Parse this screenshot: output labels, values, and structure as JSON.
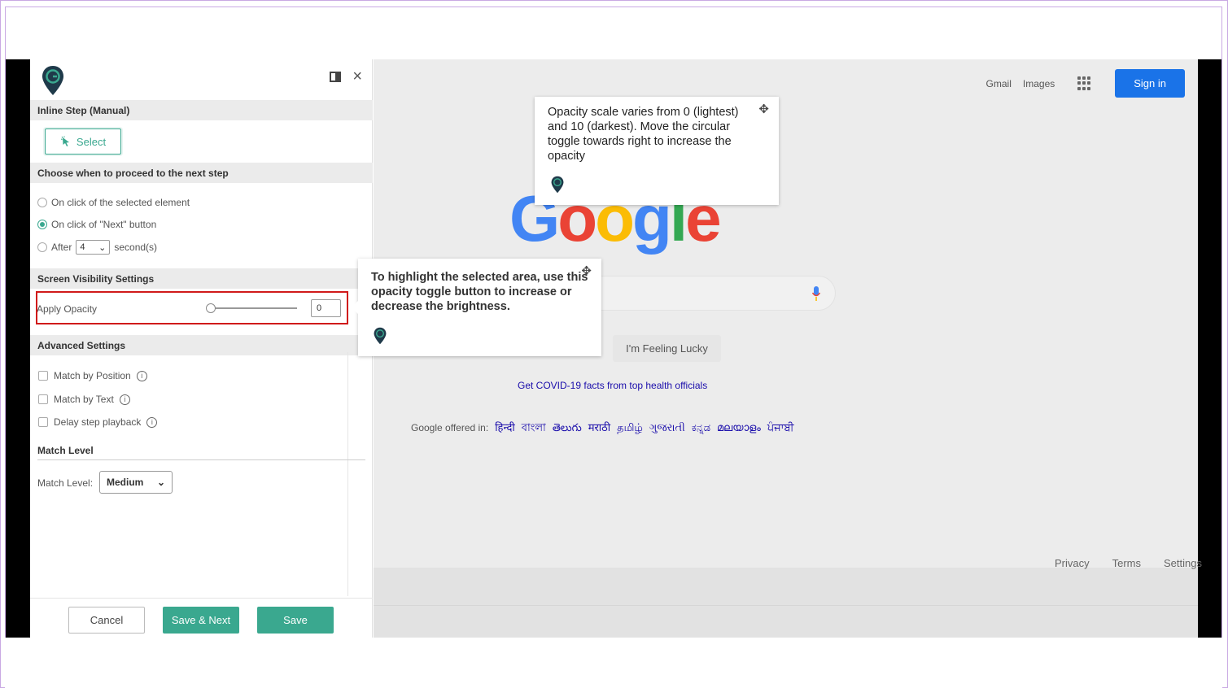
{
  "panel": {
    "inline_step_heading": "Inline Step (Manual)",
    "select_button": "Select",
    "proceed_heading": "Choose when to proceed to the next step",
    "options": {
      "on_click_element": "On click of the selected element",
      "on_click_next": "On click of \"Next\" button",
      "after_label": "After",
      "after_value": "4",
      "seconds_label": "second(s)"
    },
    "visibility_heading": "Screen Visibility Settings",
    "apply_opacity_label": "Apply Opacity",
    "opacity_value": "0",
    "advanced_heading": "Advanced Settings",
    "match_by_position": "Match by Position",
    "match_by_text": "Match by Text",
    "delay_step_playback": "Delay step playback",
    "info_glyph": "i",
    "match_level_heading": "Match Level",
    "match_level_label": "Match Level:",
    "match_level_value": "Medium",
    "cancel": "Cancel",
    "save_next": "Save & Next",
    "save": "Save"
  },
  "google": {
    "gmail": "Gmail",
    "images": "Images",
    "sign_in": "Sign in",
    "logo_letters": [
      "G",
      "o",
      "o",
      "g",
      "l",
      "e"
    ],
    "logo_colors": [
      "#4285f4",
      "#ea4335",
      "#fbbc05",
      "#4285f4",
      "#34a853",
      "#ea4335"
    ],
    "feeling_lucky": "I'm Feeling Lucky",
    "covid_link": "Get COVID-19 facts from top health officials",
    "offered_in": "Google offered in:",
    "languages": [
      "हिन्दी",
      "বাংলা",
      "తెలుగు",
      "मराठी",
      "தமிழ்",
      "ગુજરાતી",
      "ಕನ್ನಡ",
      "മലയാളം",
      "ਪੰਜਾਬੀ"
    ],
    "footer": {
      "privacy": "Privacy",
      "terms": "Terms",
      "settings": "Settings"
    }
  },
  "tooltips": {
    "opacity_scale": "Opacity scale varies from 0 (lightest) and 10 (darkest). Move the circular toggle towards right to increase the opacity",
    "highlight": "To highlight the selected area, use this opacity toggle button to increase or decrease the brightness."
  },
  "colors": {
    "accent": "#3aa88f",
    "highlight_border": "#d01a1a",
    "sign_in": "#1a73e8",
    "logo_pin": "#1f3a4a"
  },
  "icons": {
    "dock": "dock-panel-icon",
    "close": "close-icon",
    "cursor": "cursor-icon",
    "move": "move-icon",
    "apps": "apps-grid-icon",
    "mic": "mic-icon"
  }
}
